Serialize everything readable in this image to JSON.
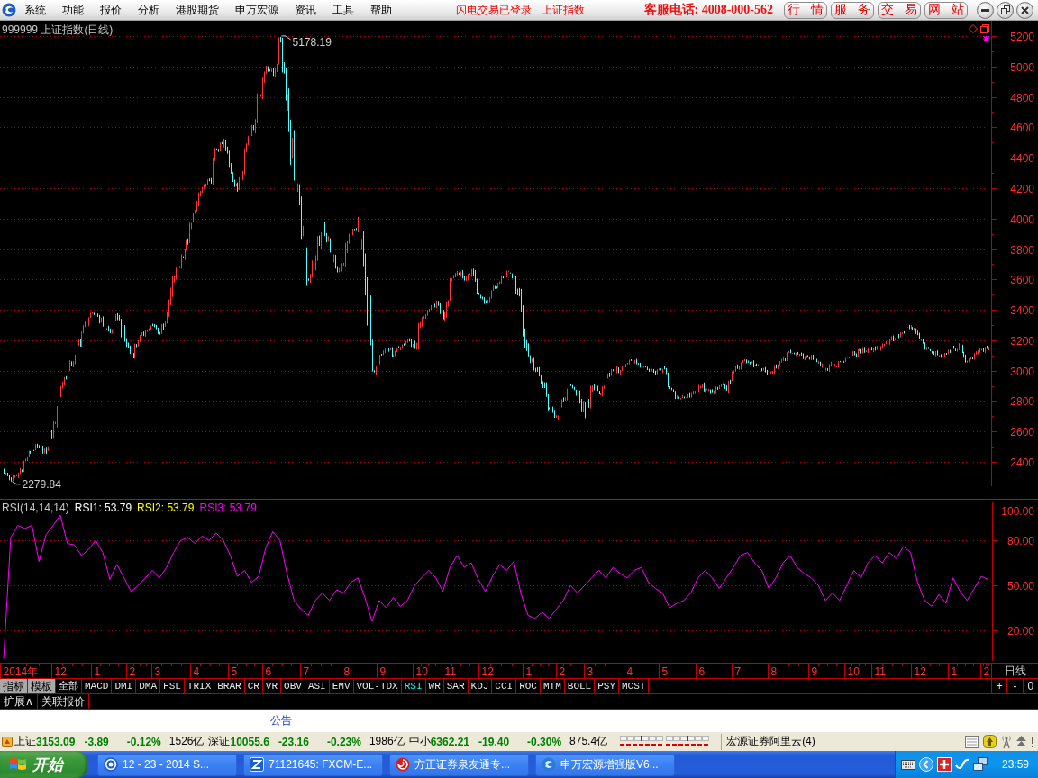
{
  "menu_bar": {
    "items": [
      "系统",
      "功能",
      "报价",
      "分析",
      "港股期货",
      "申万宏源",
      "资讯",
      "工具",
      "帮助"
    ],
    "login_status": "闪电交易已登录",
    "current_symbol": "上证指数",
    "hotline": "客服电话: 4008-000-562",
    "buttons": [
      "行 情",
      "服 务",
      "交 易",
      "网 站"
    ]
  },
  "price_chart": {
    "title": "999999 上证指数(日线)",
    "axis_labels": [
      "5200",
      "5000",
      "4800",
      "4600",
      "4400",
      "4200",
      "4000",
      "3800",
      "3600",
      "3400",
      "3200",
      "3000",
      "2800",
      "2600",
      "2400"
    ],
    "high_label": "5178.19",
    "low_label": "2279.84"
  },
  "rsi_panel": {
    "title": "RSI(14,14,14)",
    "readings": [
      {
        "label": "RSI1: 53.79",
        "color": "#ffffff"
      },
      {
        "label": "RSI2: 53.79",
        "color": "#ffff00"
      },
      {
        "label": "RSI3: 53.79",
        "color": "#ff00ff"
      }
    ],
    "chart_data": {
      "type": "line",
      "ylim": [
        -0.4,
        106
      ],
      "yticks": [
        {
          "value": 20,
          "label": "20.00"
        },
        {
          "value": 50,
          "label": "50.00"
        },
        {
          "value": 80,
          "label": "80.00"
        },
        {
          "value": 100,
          "label": "100.00"
        }
      ],
      "grid": true,
      "series": [
        {
          "color": "#ff00ff",
          "values": [
            1,
            82,
            90,
            88,
            90,
            66,
            84,
            90,
            97,
            78,
            77,
            70,
            74,
            80,
            72,
            54,
            64,
            55,
            46,
            50,
            55,
            60,
            55,
            62,
            72,
            80,
            82,
            78,
            83,
            80,
            85,
            80,
            70,
            56,
            60,
            52,
            56,
            75,
            86,
            80,
            58,
            40,
            34,
            30,
            40,
            45,
            40,
            47,
            45,
            52,
            55,
            42,
            26,
            40,
            35,
            42,
            36,
            40,
            50,
            55,
            60,
            55,
            46,
            62,
            70,
            62,
            65,
            54,
            46,
            56,
            64,
            60,
            66,
            45,
            30,
            28,
            32,
            28,
            34,
            40,
            50,
            45,
            50,
            55,
            60,
            55,
            62,
            58,
            55,
            60,
            62,
            52,
            48,
            45,
            35,
            38,
            40,
            45,
            55,
            60,
            55,
            48,
            55,
            62,
            70,
            72,
            65,
            60,
            48,
            55,
            65,
            70,
            62,
            58,
            55,
            50,
            40,
            45,
            40,
            50,
            60,
            55,
            65,
            70,
            65,
            72,
            68,
            76,
            72,
            52,
            40,
            36,
            44,
            38,
            55,
            46,
            40,
            48,
            56,
            54
          ]
        }
      ]
    }
  },
  "date_axis": {
    "labels": [
      "2014年",
      "12",
      "1",
      "2",
      "3",
      "4",
      "5",
      "6",
      "7",
      "8",
      "9",
      "10",
      "11",
      "12",
      "1",
      "2",
      "3",
      "4",
      "5",
      "6",
      "7",
      "8",
      "9",
      "10",
      "11",
      "12",
      "1",
      "2"
    ],
    "period": "日线"
  },
  "indicator_bar": {
    "modes": [
      "指标",
      "模板"
    ],
    "tabs": [
      {
        "label": "全部",
        "selected": false
      },
      {
        "label": "MACD",
        "selected": false
      },
      {
        "label": "DMI",
        "selected": false
      },
      {
        "label": "DMA",
        "selected": false
      },
      {
        "label": "FSL",
        "selected": false
      },
      {
        "label": "TRIX",
        "selected": false
      },
      {
        "label": "BRAR",
        "selected": false
      },
      {
        "label": "CR",
        "selected": false
      },
      {
        "label": "VR",
        "selected": false
      },
      {
        "label": "OBV",
        "selected": false
      },
      {
        "label": "ASI",
        "selected": false
      },
      {
        "label": "EMV",
        "selected": false
      },
      {
        "label": "VOL-TDX",
        "selected": false
      },
      {
        "label": "RSI",
        "selected": true
      },
      {
        "label": "WR",
        "selected": false
      },
      {
        "label": "SAR",
        "selected": false
      },
      {
        "label": "KDJ",
        "selected": false
      },
      {
        "label": "CCI",
        "selected": false
      },
      {
        "label": "ROC",
        "selected": false
      },
      {
        "label": "MTM",
        "selected": false
      },
      {
        "label": "BOLL",
        "selected": false
      },
      {
        "label": "PSY",
        "selected": false
      },
      {
        "label": "MCST",
        "selected": false
      }
    ],
    "zoom_buttons": [
      "+",
      "-",
      "0"
    ]
  },
  "sub_tabs": [
    "扩展∧",
    "关联报价"
  ],
  "notice_bar": {
    "label": "公告"
  },
  "status_bar": {
    "indices": [
      {
        "name": "上证",
        "value": "3153.09",
        "change": "-3.89",
        "percent": "-0.12%",
        "turnover": "1526亿"
      },
      {
        "name": "深证",
        "value": "10055.6",
        "change": "-23.16",
        "percent": "-0.23%",
        "turnover": "1986亿"
      },
      {
        "name": "中小",
        "value": "6362.21",
        "change": "-19.40",
        "percent": "-0.30%",
        "turnover": "875.4亿"
      }
    ],
    "server": "宏源证券阿里云(4)"
  },
  "taskbar": {
    "start": "开始",
    "tasks": [
      {
        "kind": "ring",
        "label": "12 - 23 - 2014 S...",
        "selected": false
      },
      {
        "kind": "tile",
        "label": "71121645: FXCM-E...",
        "selected": false
      },
      {
        "kind": "swirl",
        "label": "方正证券泉友通专...",
        "selected": false
      },
      {
        "kind": "orb",
        "label": "申万宏源增强版V6...",
        "selected": false
      }
    ],
    "clock": "23:59"
  }
}
